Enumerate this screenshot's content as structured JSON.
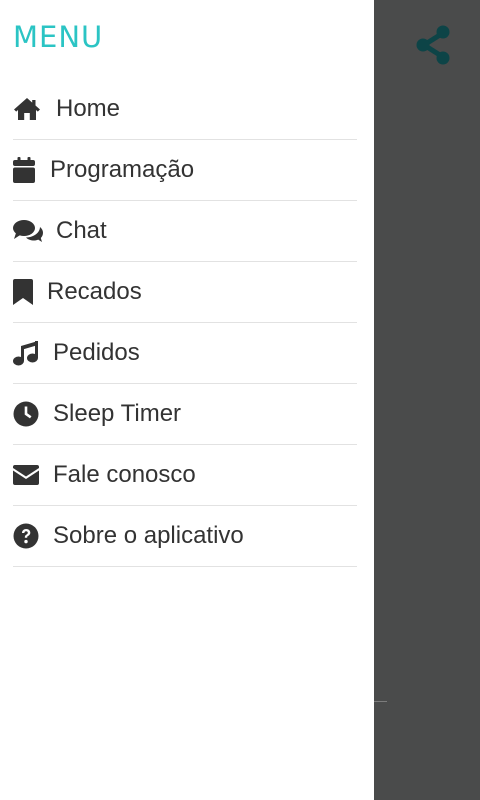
{
  "colors": {
    "accent": "#2bc4c4",
    "text": "#333333",
    "overlay": "#4a4b4b",
    "share_icon": "#0d4447",
    "divider": "#e2e2e2"
  },
  "drawer": {
    "title": "MENU",
    "items": [
      {
        "label": "Home",
        "icon": "home-icon"
      },
      {
        "label": "Programação",
        "icon": "calendar-icon"
      },
      {
        "label": "Chat",
        "icon": "chat-icon"
      },
      {
        "label": "Recados",
        "icon": "bookmark-icon"
      },
      {
        "label": "Pedidos",
        "icon": "music-icon"
      },
      {
        "label": "Sleep Timer",
        "icon": "clock-icon"
      },
      {
        "label": "Fale conosco",
        "icon": "envelope-icon"
      },
      {
        "label": "Sobre o aplicativo",
        "icon": "question-circle-icon"
      }
    ]
  },
  "background": {
    "share_icon": "share-icon"
  }
}
